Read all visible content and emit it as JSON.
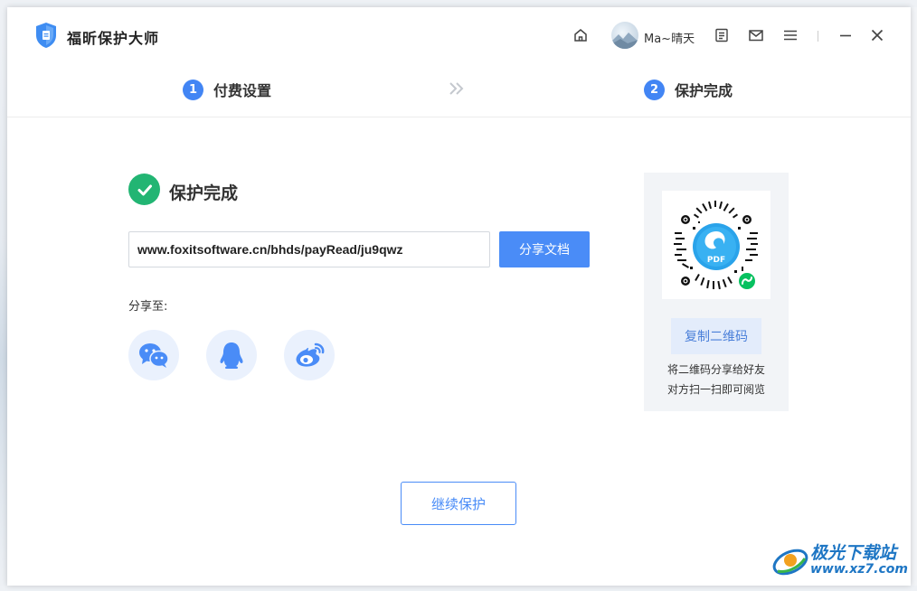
{
  "app": {
    "title": "福昕保护大师"
  },
  "user": {
    "name": "Ma~晴天"
  },
  "titlebar_icons": [
    "home-icon",
    "avatar",
    "clipboard-icon",
    "mail-icon",
    "menu-icon",
    "minimize-icon",
    "close-icon"
  ],
  "steps": [
    {
      "number": "1",
      "label": "付费设置"
    },
    {
      "number": "2",
      "label": "保护完成"
    }
  ],
  "step_separator": "»",
  "result": {
    "title": "保护完成",
    "url": "www.foxitsoftware.cn/bhds/payRead/ju9qwz",
    "share_doc_label": "分享文档",
    "share_to_label": "分享至:",
    "share_targets": [
      "wechat-icon",
      "qq-icon",
      "weibo-icon"
    ]
  },
  "qr": {
    "center_label": "PDF",
    "copy_label": "复制二维码",
    "hint_line1": "将二维码分享给好友",
    "hint_line2": "对方扫一扫即可阅览"
  },
  "continue_label": "继续保护",
  "watermark": {
    "title": "极光下载站",
    "url": "www.xz7.com"
  },
  "colors": {
    "accent": "#4a8cf7",
    "success": "#22b573",
    "step": "#4285f4"
  }
}
